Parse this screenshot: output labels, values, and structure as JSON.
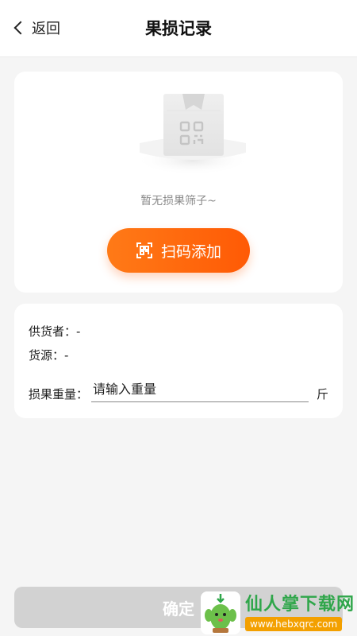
{
  "header": {
    "back_label": "返回",
    "title": "果损记录"
  },
  "empty_state": {
    "message": "暂无损果筛子~",
    "scan_button_label": "扫码添加",
    "illustration_icon": "empty-box-qr-icon",
    "scan_icon": "qr-scan-icon"
  },
  "info": {
    "supplier_label": "供货者：-",
    "source_label": "货源：-",
    "weight_label": "损果重量：",
    "weight_placeholder": "请输入重量",
    "weight_value": "",
    "weight_unit": "斤"
  },
  "footer": {
    "confirm_label": "确定"
  },
  "watermark": {
    "title": "仙人掌下载网",
    "url": "www.hebxqrc.com",
    "logo_icon": "cactus-logo-icon"
  },
  "colors": {
    "accent": "#ff6a0a",
    "page_bg": "#f5f5f5",
    "card_bg": "#ffffff",
    "disabled_button": "#d2d2d2",
    "watermark_green": "#2fa64a",
    "watermark_orange": "#f3a000"
  }
}
